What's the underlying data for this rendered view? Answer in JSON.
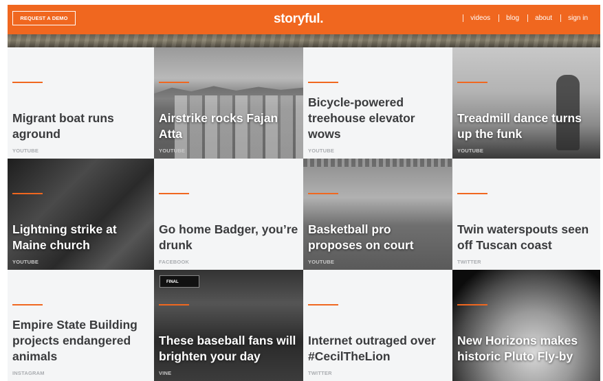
{
  "header": {
    "demo_button": "REQUEST A DEMO",
    "logo": "storyful.",
    "nav": [
      "videos",
      "blog",
      "about",
      "sign in"
    ]
  },
  "colors": {
    "accent": "#f0671f",
    "tile_bg": "#f4f5f6",
    "title_text": "#3a3b3d",
    "source_text": "#a9acb0"
  },
  "tiles": [
    {
      "title": "Migrant boat runs aground",
      "source": "YOUTUBE"
    },
    {
      "title": "Airstrike rocks Fajan Atta",
      "source": "YOUTUBE"
    },
    {
      "title": "Bicycle-powered treehouse elevator wows",
      "source": "YOUTUBE"
    },
    {
      "title": "Treadmill dance turns up the funk",
      "source": "YOUTUBE"
    },
    {
      "title": "Lightning strike at Maine church",
      "source": "YOUTUBE"
    },
    {
      "title": "Go home Badger, you’re drunk",
      "source": "FACEBOOK"
    },
    {
      "title": "Basketball pro proposes on court",
      "source": "YOUTUBE"
    },
    {
      "title": "Twin waterspouts seen off Tuscan coast",
      "source": "TWITTER"
    },
    {
      "title": "Empire State Building projects endangered animals",
      "source": "INSTAGRAM"
    },
    {
      "title": "These baseball fans will brighten your day",
      "source": "VINE",
      "overlay": "FINAL"
    },
    {
      "title": "Internet outraged over #CecilTheLion",
      "source": "TWITTER"
    },
    {
      "title": "New Horizons makes historic Pluto Fly-by",
      "source": ""
    }
  ]
}
